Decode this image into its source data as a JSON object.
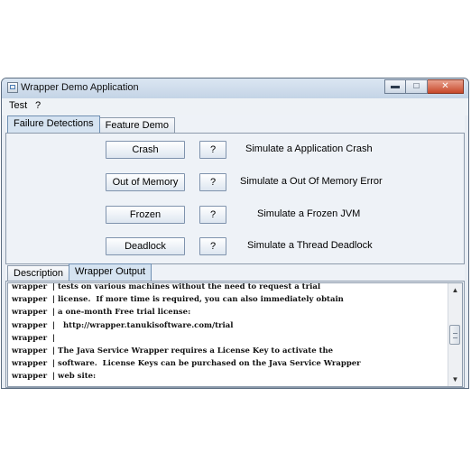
{
  "window": {
    "title": "Wrapper Demo Application",
    "minimize_glyph": "▬",
    "maximize_glyph": "□",
    "close_glyph": "✕"
  },
  "menu": [
    {
      "label": "Test"
    },
    {
      "label": "?"
    }
  ],
  "top_tabs": [
    {
      "label": "Failure Detections",
      "active": true
    },
    {
      "label": "Feature Demo",
      "active": false
    }
  ],
  "failures": [
    {
      "button": "Crash",
      "help": "?",
      "description": "Simulate a Application Crash"
    },
    {
      "button": "Out of Memory",
      "help": "?",
      "description": "Simulate a Out Of Memory Error"
    },
    {
      "button": "Frozen",
      "help": "?",
      "description": "Simulate a Frozen JVM"
    },
    {
      "button": "Deadlock",
      "help": "?",
      "description": "Simulate a Thread Deadlock"
    }
  ],
  "bottom_tabs": [
    {
      "label": "Description",
      "active": false
    },
    {
      "label": "Wrapper Output",
      "active": true
    }
  ],
  "console_lines": [
    "wrapper  | tests on various machines without the need to request a trial",
    "wrapper  | license.  If more time is required, you can also immediately obtain",
    "wrapper  | a one-month Free trial license:",
    "wrapper  |   http://wrapper.tanukisoftware.com/trial",
    "wrapper  |",
    "wrapper  | The Java Service Wrapper requires a License Key to activate the",
    "wrapper  | software.  License Keys can be purchased on the Java Service Wrapper",
    "wrapper  | web site:"
  ],
  "scrollbar": {
    "up_glyph": "▲",
    "down_glyph": "▼"
  }
}
